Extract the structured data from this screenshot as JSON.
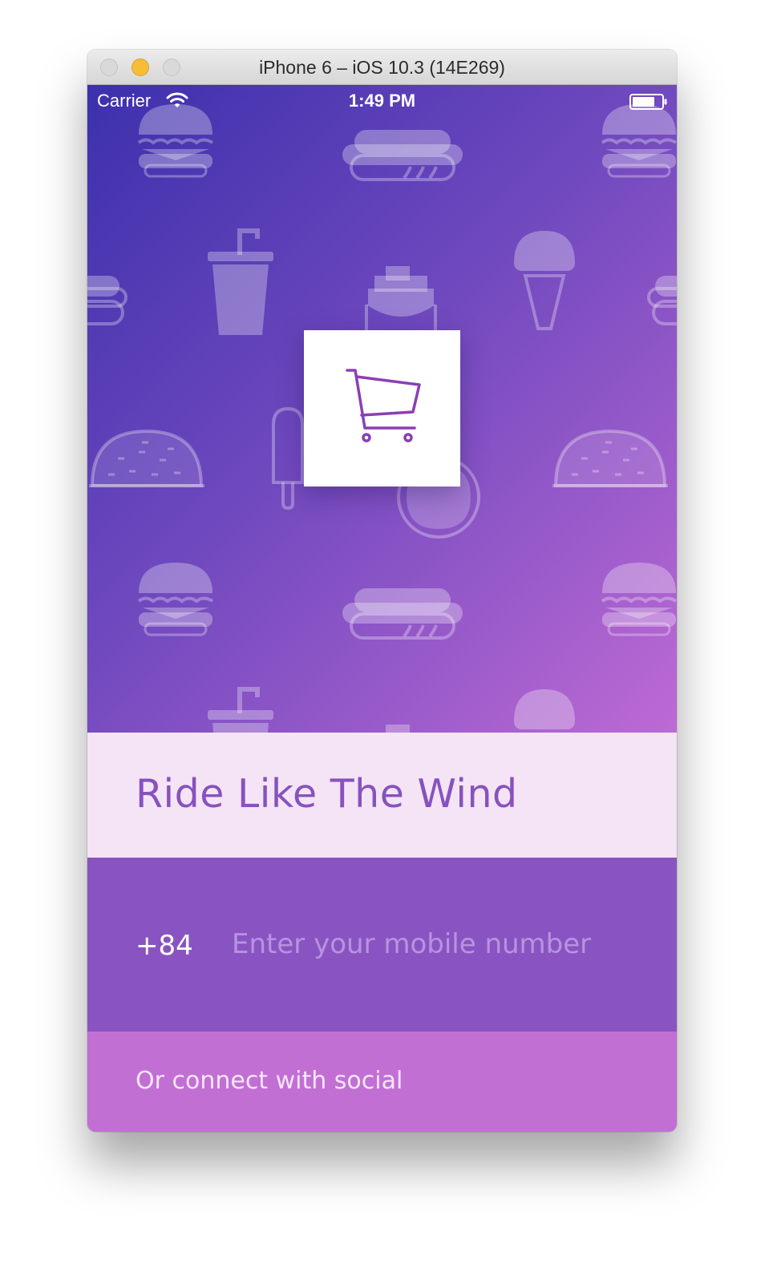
{
  "window": {
    "title": "iPhone 6 – iOS 10.3 (14E269)"
  },
  "status_bar": {
    "carrier": "Carrier",
    "time": "1:49 PM",
    "icons": [
      "wifi-icon",
      "battery-icon"
    ]
  },
  "background_icons": [
    "burger-icon",
    "hotdog-icon",
    "drink-cup-icon",
    "fries-icon",
    "ice-cream-cone-icon",
    "taco-icon",
    "popsicle-icon",
    "donut-icon"
  ],
  "logo": {
    "icon": "shopping-cart-icon",
    "color": "#8b3fb4"
  },
  "headline": {
    "text": "Ride Like The Wind"
  },
  "phone": {
    "country_code": "+84",
    "value": "",
    "placeholder": "Enter your mobile number"
  },
  "social": {
    "label": "Or connect with social"
  },
  "colors": {
    "gradient_start": "#3c30ac",
    "gradient_end": "#bd6ad4",
    "headline_band": "#f4e4f6",
    "headline_text": "#8752be",
    "phone_band": "#8954c2",
    "social_band": "#c26fd4"
  }
}
